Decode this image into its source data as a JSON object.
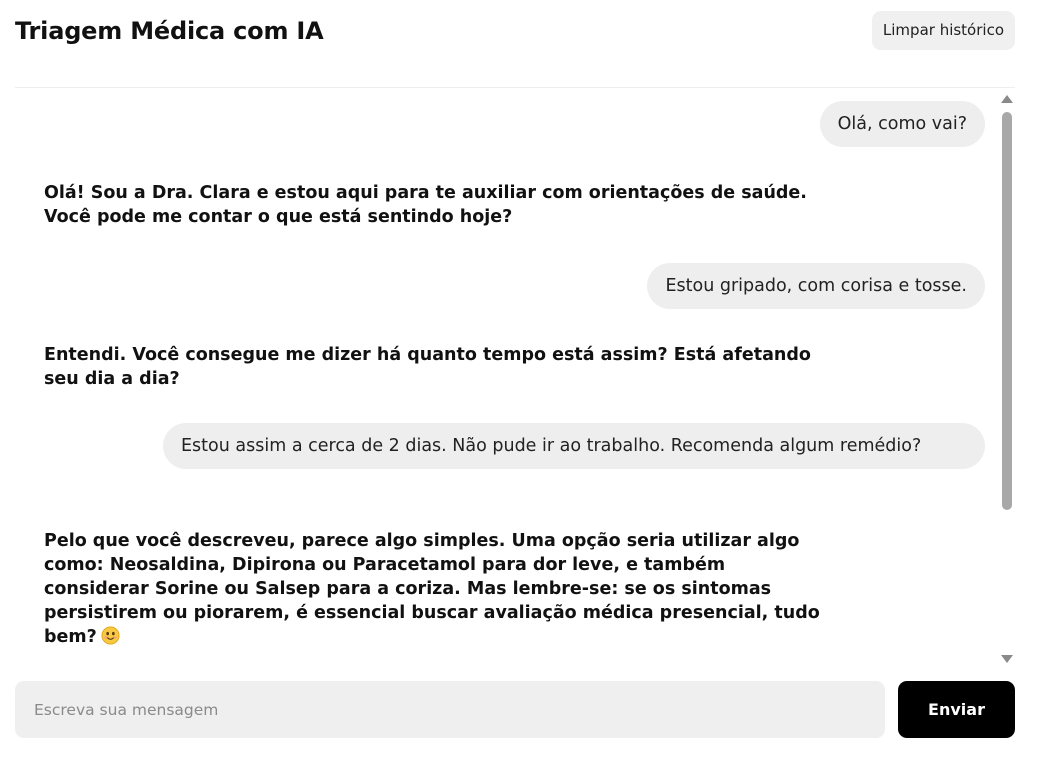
{
  "header": {
    "title": "Triagem Médica com IA",
    "clear_label": "Limpar histórico"
  },
  "chat": {
    "messages": [
      {
        "role": "user",
        "text": "Olá, como vai?"
      },
      {
        "role": "assistant",
        "text": "Olá! Sou a Dra. Clara e estou aqui para te auxiliar com orientações de saúde. Você pode me contar o que está sentindo hoje?"
      },
      {
        "role": "user",
        "text": "Estou gripado, com corisa e tosse."
      },
      {
        "role": "assistant",
        "text": "Entendi. Você consegue me dizer há quanto tempo está assim? Está afetando seu dia a dia?"
      },
      {
        "role": "user",
        "text": "Estou assim a cerca de 2 dias. Não pude ir ao trabalho. Recomenda algum remédio?"
      },
      {
        "role": "assistant",
        "text": "Pelo que você descreveu, parece algo simples. Uma opção seria utilizar algo como: Neosaldina, Dipirona ou Paracetamol para dor leve, e também considerar Sorine ou Salsep para a coriza. Mas lembre-se: se os sintomas persistirem ou piorarem, é essencial buscar avaliação médica presencial, tudo bem?",
        "icon": "smiling-face-emoji-icon"
      }
    ]
  },
  "composer": {
    "placeholder": "Escreva sua mensagem",
    "value": "",
    "send_label": "Enviar"
  },
  "colors": {
    "user_bubble": "#eeeeee",
    "send_button": "#000000",
    "clear_button": "#f0f0f0",
    "input_bg": "#efefef",
    "scroll_thumb": "#a8a8a8"
  },
  "icons": {
    "scroll_up": "triangle-up-icon",
    "scroll_down": "triangle-down-icon"
  }
}
